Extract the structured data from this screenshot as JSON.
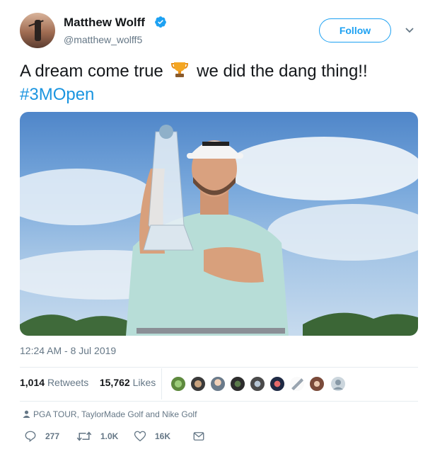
{
  "user": {
    "display_name": "Matthew Wolff",
    "handle": "@matthew_wolff5",
    "follow_label": "Follow"
  },
  "tweet": {
    "text_part1": "A dream come true",
    "text_part2": "we did the dang thing!!",
    "hashtag": "#3MOpen",
    "emoji": "trophy-icon"
  },
  "meta": {
    "timestamp": "12:24 AM - 8 Jul 2019",
    "retweets_count": "1,014",
    "retweets_label": "Retweets",
    "likes_count": "15,762",
    "likes_label": "Likes",
    "tagged": "PGA TOUR, TaylorMade Golf and Nike Golf"
  },
  "actions": {
    "replies": "277",
    "retweets": "1.0K",
    "likes": "16K"
  },
  "colors": {
    "accent": "#1da1f2",
    "hashtag": "#1b95e0",
    "muted": "#657786",
    "text": "#14171a"
  }
}
